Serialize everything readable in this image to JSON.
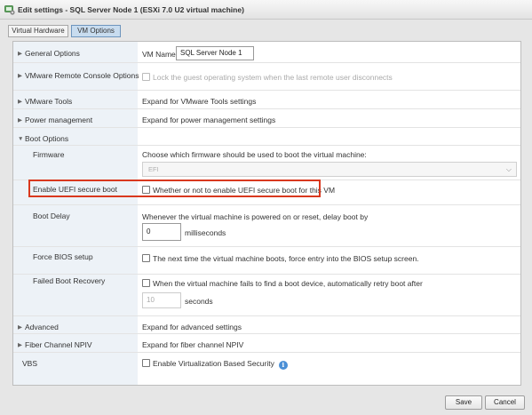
{
  "window": {
    "title": "Edit settings - SQL Server Node 1 (ESXi 7.0 U2 virtual machine)",
    "icon": "vm-settings-icon"
  },
  "tabs": [
    {
      "label": "Virtual Hardware",
      "active": false
    },
    {
      "label": "VM Options",
      "active": true
    }
  ],
  "options": {
    "general": {
      "label": "General Options",
      "vm_name_label": "VM Name:",
      "vm_name_value": "SQL Server Node 1"
    },
    "vmrc": {
      "label": "VMware Remote Console Options",
      "lock_text": "Lock the guest operating system when the last remote user disconnects"
    },
    "tools": {
      "label": "VMware Tools",
      "value": "Expand for VMware Tools settings"
    },
    "power": {
      "label": "Power management",
      "value": "Expand for power management settings"
    },
    "boot": {
      "label": "Boot Options",
      "firmware": {
        "label": "Firmware",
        "description": "Choose which firmware should be used to boot the virtual machine:",
        "selected": "EFI"
      },
      "uefi": {
        "label": "Enable UEFI secure boot",
        "text": "Whether or not to enable UEFI secure boot for this VM"
      },
      "delay": {
        "label": "Boot Delay",
        "description": "Whenever the virtual machine is powered on or reset, delay boot by",
        "value": "0",
        "unit": "milliseconds"
      },
      "bios": {
        "label": "Force BIOS setup",
        "text": "The next time the virtual machine boots, force entry into the BIOS setup screen."
      },
      "recovery": {
        "label": "Failed Boot Recovery",
        "text": "When the virtual machine fails to find a boot device, automatically retry boot after",
        "value": "10",
        "unit": "seconds"
      }
    },
    "advanced": {
      "label": "Advanced",
      "value": "Expand for advanced settings"
    },
    "fc": {
      "label": "Fiber Channel NPIV",
      "value": "Expand for fiber channel NPIV"
    },
    "vbs": {
      "label": "VBS",
      "text": "Enable Virtualization Based Security"
    }
  },
  "buttons": {
    "save": "Save",
    "cancel": "Cancel"
  },
  "colors": {
    "highlight": "#d9381e",
    "active_tab": "#c8dcef",
    "label_rail": "#edf2f7",
    "info": "#4a8fd6"
  }
}
